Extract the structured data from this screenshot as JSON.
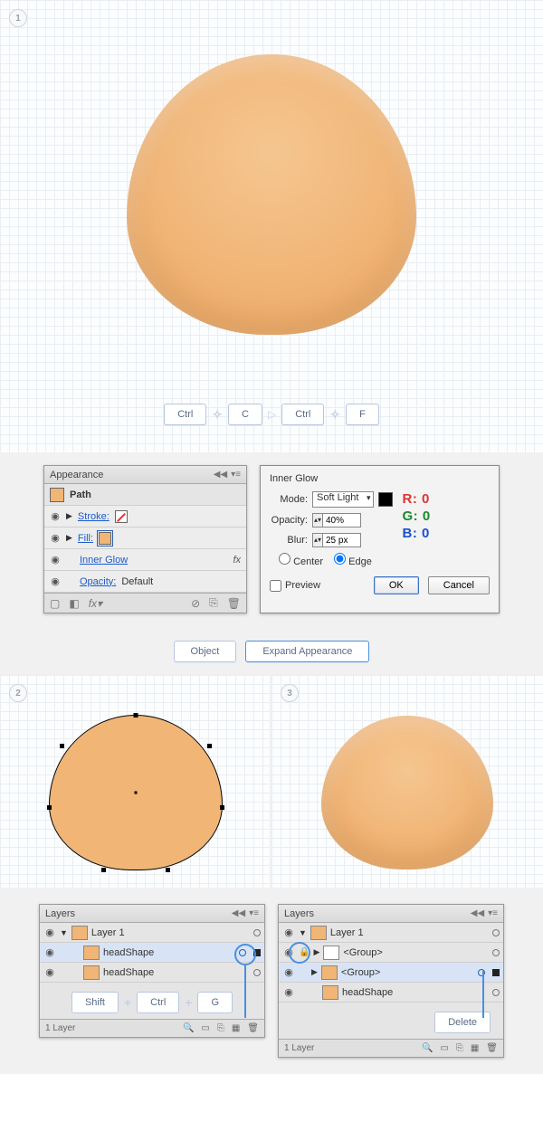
{
  "steps": {
    "one": "1",
    "two": "2",
    "three": "3"
  },
  "keys": {
    "ctrl": "Ctrl",
    "c": "C",
    "f": "F",
    "shift": "Shift",
    "g": "G",
    "delete": "Delete"
  },
  "appearance": {
    "title": "Appearance",
    "pathLabel": "Path",
    "strokeLabel": "Stroke:",
    "fillLabel": "Fill:",
    "innerGlow": "Inner Glow",
    "opacityLabel": "Opacity:",
    "opacityValue": "Default",
    "fxLabel": "fx"
  },
  "innerGlow": {
    "title": "Inner Glow",
    "modeLabel": "Mode:",
    "modeValue": "Soft Light",
    "opacityLabel": "Opacity:",
    "opacityValue": "40%",
    "blurLabel": "Blur:",
    "blurValue": "25 px",
    "centerLabel": "Center",
    "edgeLabel": "Edge",
    "preview": "Preview",
    "ok": "OK",
    "cancel": "Cancel",
    "rgb": {
      "r": "R: 0",
      "g": "G: 0",
      "b": "B: 0"
    }
  },
  "menu": {
    "object": "Object",
    "expand": "Expand Appearance"
  },
  "layers": {
    "title": "Layers",
    "layer1": "Layer 1",
    "headShape": "headShape",
    "group": "<Group>",
    "footer": "1 Layer"
  }
}
